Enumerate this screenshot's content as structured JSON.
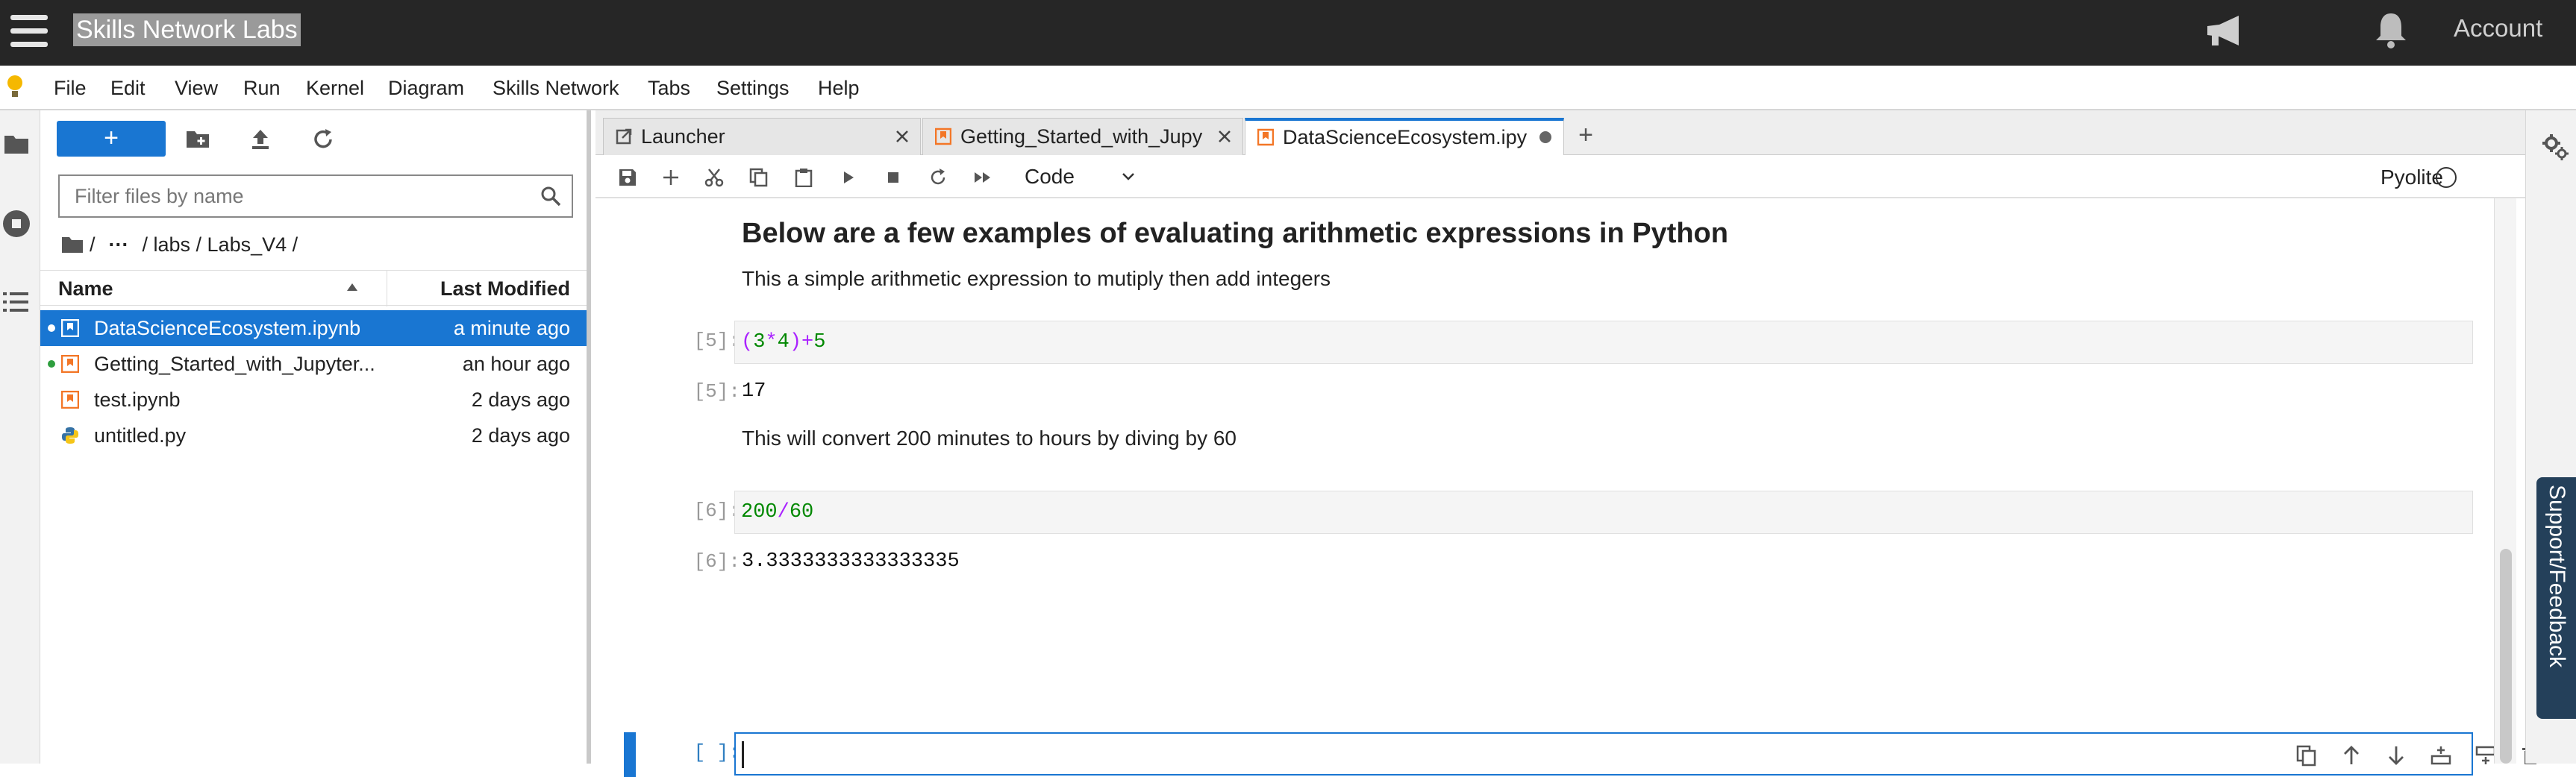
{
  "header": {
    "brand": "Skills Network Labs",
    "account": "Account",
    "icons": [
      "hamburger-icon",
      "megaphone-icon",
      "bell-icon"
    ]
  },
  "menu": {
    "items": [
      "File",
      "Edit",
      "View",
      "Run",
      "Kernel",
      "Diagram",
      "Skills Network",
      "Tabs",
      "Settings",
      "Help"
    ]
  },
  "filebrowser": {
    "new_label": "+",
    "filter_placeholder": "Filter files by name",
    "breadcrumb": {
      "root": "/",
      "ellipsis": "···",
      "path": "/ labs / Labs_V4 /"
    },
    "columns": {
      "name": "Name",
      "modified": "Last Modified"
    },
    "files": [
      {
        "name": "DataScienceEcosystem.ipynb",
        "modified": "a minute ago",
        "type": "notebook",
        "selected": true,
        "running": true
      },
      {
        "name": "Getting_Started_with_Jupyter...",
        "modified": "an hour ago",
        "type": "notebook",
        "selected": false,
        "running": true
      },
      {
        "name": "test.ipynb",
        "modified": "2 days ago",
        "type": "notebook",
        "selected": false,
        "running": false
      },
      {
        "name": "untitled.py",
        "modified": "2 days ago",
        "type": "python",
        "selected": false,
        "running": false
      }
    ]
  },
  "tabs": [
    {
      "label": "Launcher",
      "active": false
    },
    {
      "label": "Getting_Started_with_Jupy",
      "active": false
    },
    {
      "label": "DataScienceEcosystem.ipy",
      "active": true
    }
  ],
  "add_tab": "+",
  "toolbar": {
    "cell_type": "Code",
    "kernel": "Pyolite"
  },
  "notebook": {
    "heading": "Below are a few examples of evaluating arithmetic expressions in Python",
    "md1": "This a simple arithmetic expression to mutiply then add integers",
    "cell1": {
      "in_prompt": "[5]:",
      "out_prompt": "[5]:",
      "output": "17"
    },
    "md2": "This will convert 200 minutes to hours by diving by 60",
    "cell2": {
      "in_prompt": "[6]:",
      "out_prompt": "[6]:",
      "output": "3.3333333333333335"
    },
    "cell3": {
      "in_prompt": "[ ]:"
    }
  },
  "sidebar_right": {
    "support": "Support/Feedback"
  },
  "colors": {
    "accent": "#1976d2",
    "topbar": "#262626",
    "notebook_icon": "#f37626",
    "support": "#24405a"
  }
}
